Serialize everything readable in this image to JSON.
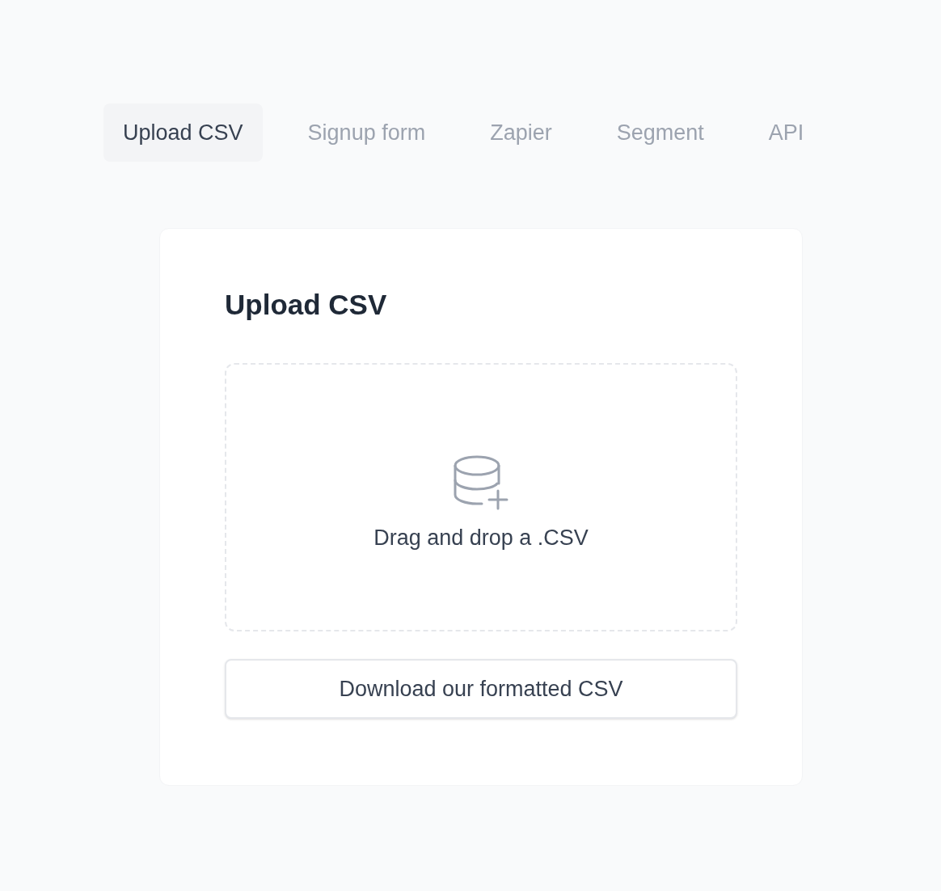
{
  "tabs": [
    {
      "label": "Upload CSV",
      "selected": true
    },
    {
      "label": "Signup form",
      "selected": false
    },
    {
      "label": "Zapier",
      "selected": false
    },
    {
      "label": "Segment",
      "selected": false
    },
    {
      "label": "API",
      "selected": false
    }
  ],
  "card": {
    "title": "Upload CSV",
    "dropzone": {
      "text": "Drag and drop a .CSV"
    },
    "button": "Download our formatted CSV"
  }
}
